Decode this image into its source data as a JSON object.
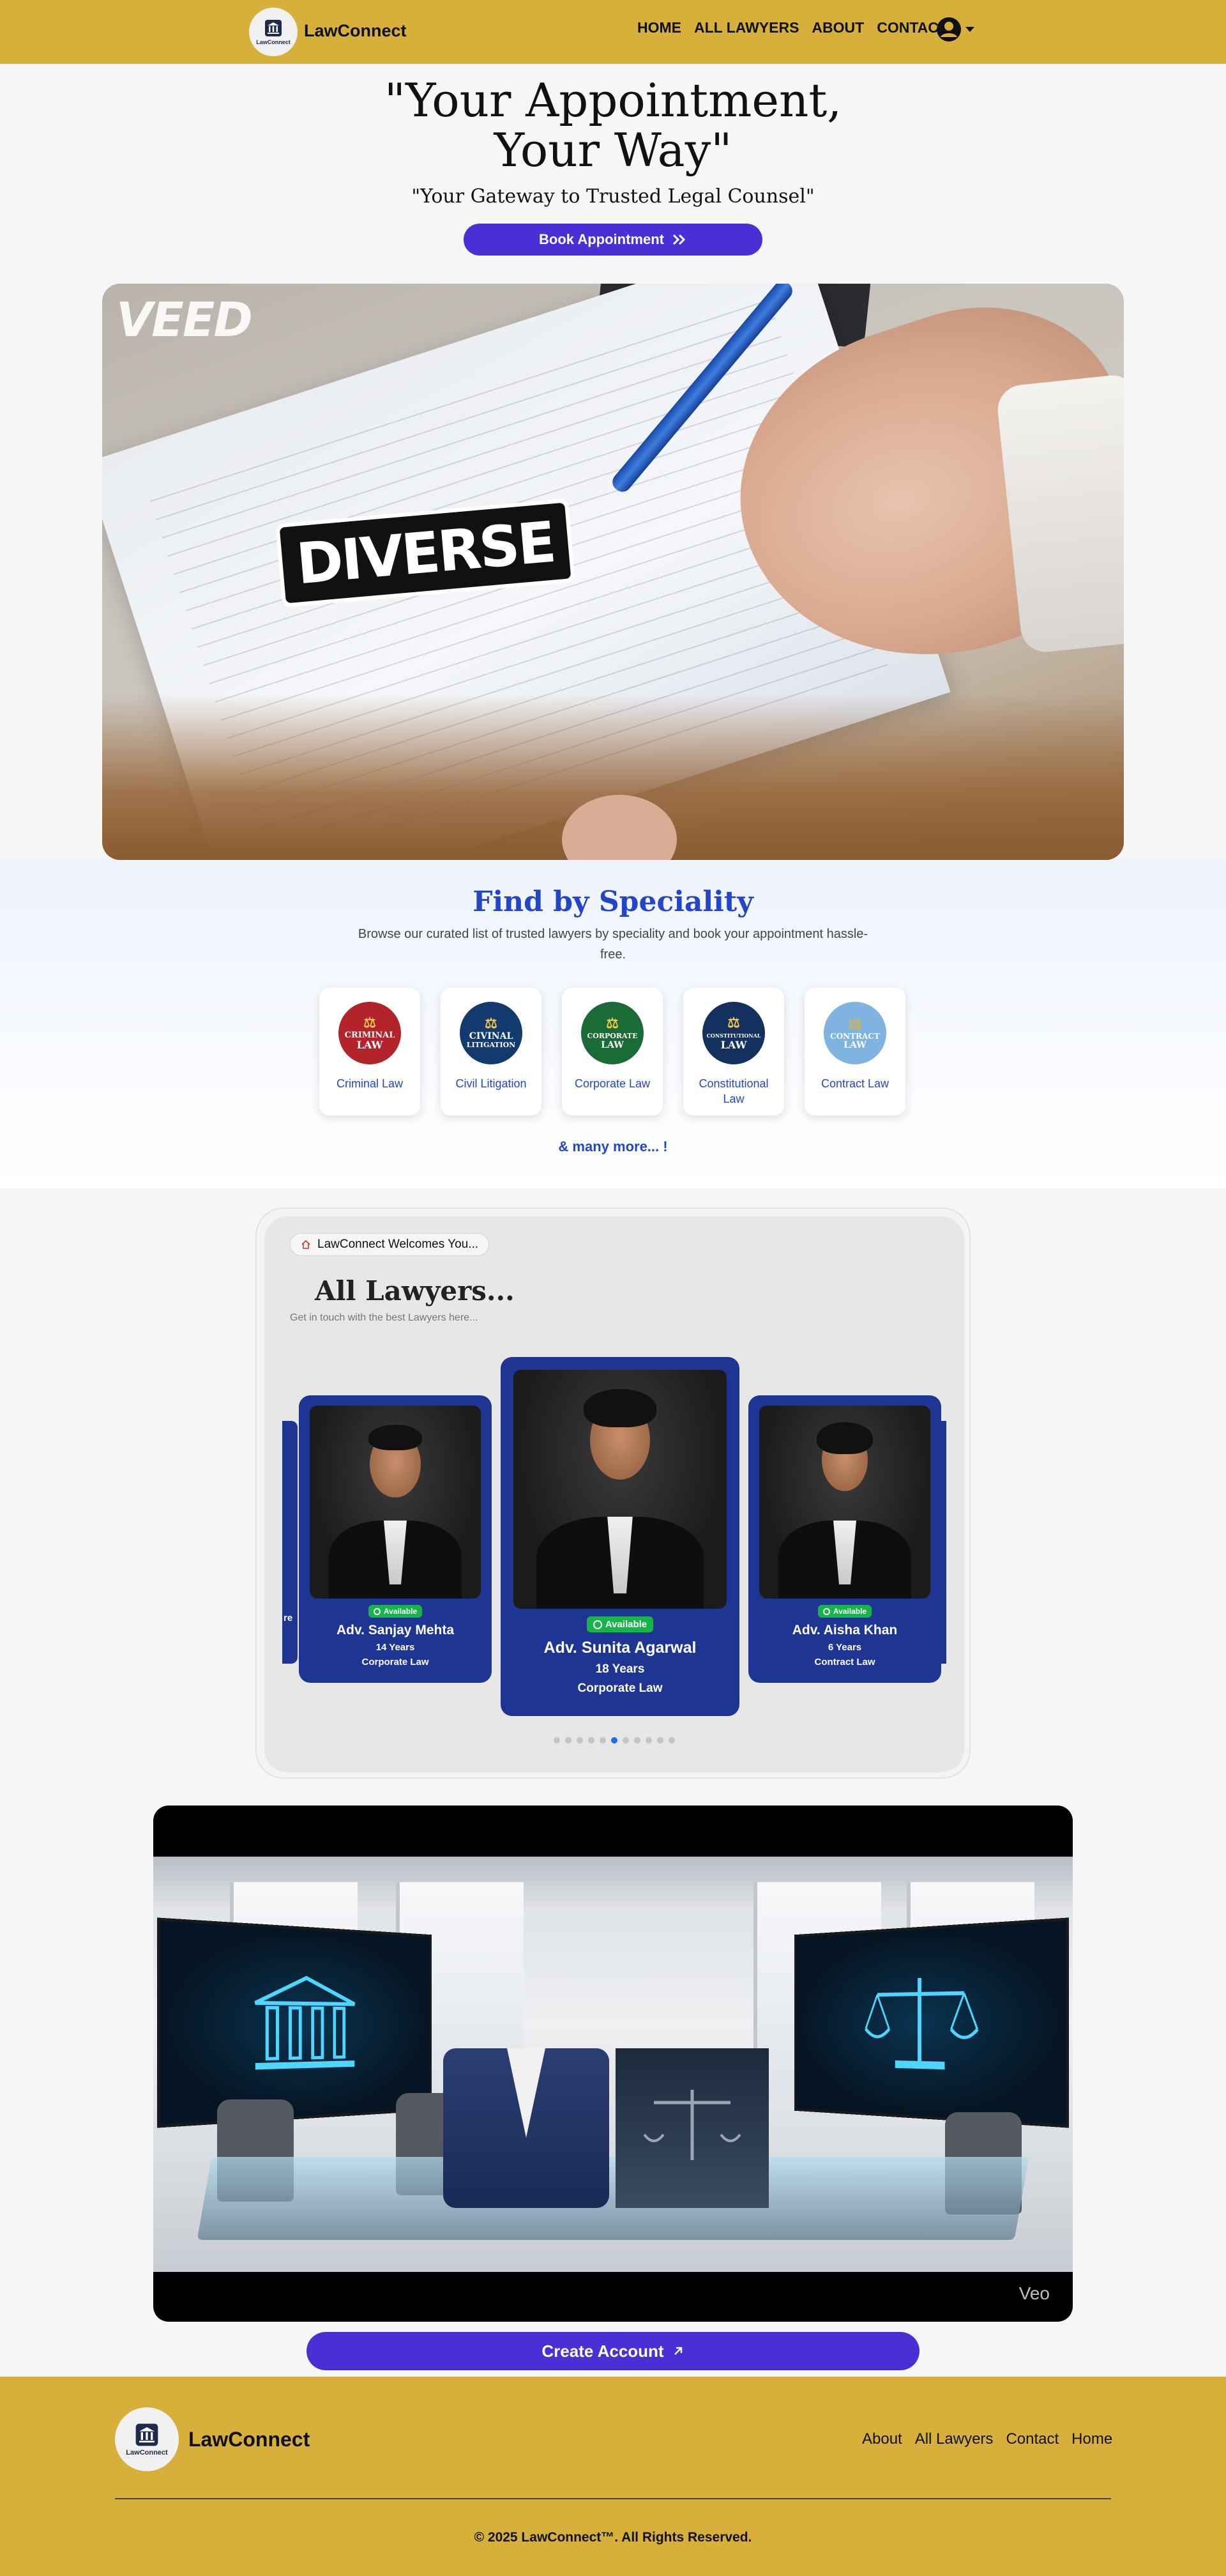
{
  "nav": {
    "brand": "LawConnect",
    "logo_text": "LawConnect",
    "links": [
      "HOME",
      "ALL LAWYERS",
      "ABOUT",
      "CONTACT"
    ],
    "user_icon": "user-circle-icon"
  },
  "hero": {
    "title_line1": "\"Your Appointment,",
    "title_line2": "Your Way\"",
    "subtitle": "\"Your Gateway to Trusted Legal Counsel\"",
    "book_label": "Book Appointment",
    "video_watermark": "VEED",
    "video_caption": "DIVERSE"
  },
  "speciality": {
    "title": "Find by Speciality",
    "description": "Browse our curated list of trusted lawyers by speciality and book your appointment hassle-free.",
    "items": [
      {
        "name": "Criminal Law",
        "badge_line1": "CRIMINAL",
        "badge_line2": "LAW",
        "color": "#b3232b"
      },
      {
        "name": "Civil Litigation",
        "badge_line1": "CIVINAL",
        "badge_line2": "LITIGATION",
        "color": "#123a6e"
      },
      {
        "name": "Corporate Law",
        "badge_line1": "CORPORATE",
        "badge_line2": "LAW",
        "color": "#1b6b37"
      },
      {
        "name": "Constitutional Law",
        "badge_line1": "CONSTITUTIONAL",
        "badge_line2": "LAW",
        "color": "#13305e"
      },
      {
        "name": "Contract Law",
        "badge_line1": "CONTRACT",
        "badge_line2": "LAW",
        "color": "#7fb3e0"
      }
    ],
    "more": "& many more... !"
  },
  "lawyers": {
    "welcome": "LawConnect Welcomes You...",
    "title": "All Lawyers...",
    "subtitle": "Get in touch with the best Lawyers here...",
    "edge_left_text": "re",
    "cards": [
      {
        "name": "Adv. Sanjay Mehta",
        "experience": "14 Years",
        "speciality": "Corporate Law",
        "status": "Available"
      },
      {
        "name": "Adv. Sunita Agarwal",
        "experience": "18 Years",
        "speciality": "Corporate Law",
        "status": "Available"
      },
      {
        "name": "Adv. Aisha Khan",
        "experience": "6 Years",
        "speciality": "Contract Law",
        "status": "Available"
      }
    ],
    "dots_count": 11,
    "active_dot": 5
  },
  "promo_video": {
    "watermark": "Veo"
  },
  "create_account_label": "Create Account",
  "footer": {
    "brand": "LawConnect",
    "logo_text": "LawConnect",
    "links": [
      "About",
      "All Lawyers",
      "Contact",
      "Home"
    ],
    "copyright": "© 2025 LawConnect™. All Rights Reserved."
  },
  "colors": {
    "gold": "#d6b03a",
    "primary_button": "#4a2fd4",
    "lawyer_card": "#1e3594",
    "accent_blue": "#2346c9",
    "available_green": "#18b44b"
  }
}
